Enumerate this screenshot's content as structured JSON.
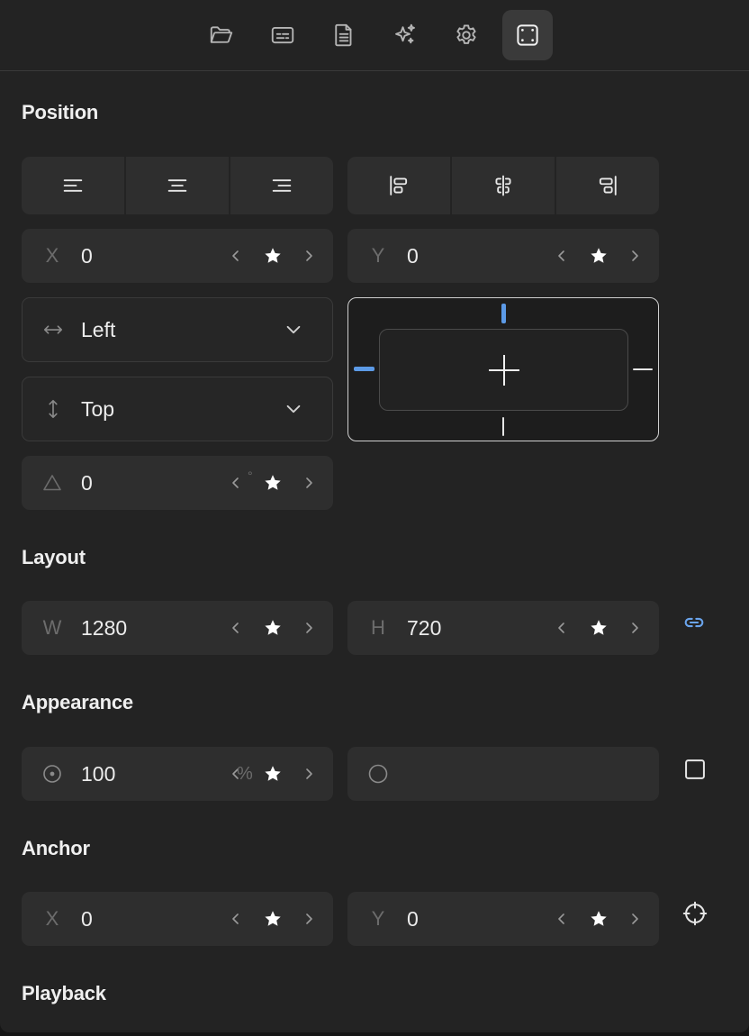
{
  "toolbar": {
    "tabs": [
      {
        "icon": "folder-open-icon"
      },
      {
        "icon": "caption-icon"
      },
      {
        "icon": "document-icon"
      },
      {
        "icon": "sparkles-icon"
      },
      {
        "icon": "gear-icon"
      },
      {
        "icon": "frame-icon",
        "active": true
      }
    ]
  },
  "position": {
    "title": "Position",
    "align_buttons": [
      "align-left-icon",
      "align-center-icon",
      "align-right-icon",
      "align-top-icon",
      "align-vertical-center-icon",
      "align-bottom-icon"
    ],
    "x": {
      "label": "X",
      "value": "0"
    },
    "y": {
      "label": "Y",
      "value": "0"
    },
    "horizontal_anchor": {
      "icon": "arrows-horizontal-icon",
      "value": "Left"
    },
    "vertical_anchor": {
      "icon": "arrows-vertical-icon",
      "value": "Top"
    },
    "rotation": {
      "icon": "triangle-icon",
      "value": "0",
      "unit": "°"
    },
    "anchor_grid": {
      "active_sides": [
        "top",
        "left"
      ]
    }
  },
  "layout": {
    "title": "Layout",
    "width": {
      "label": "W",
      "value": "1280"
    },
    "height": {
      "label": "H",
      "value": "720"
    },
    "link_icon": "link-icon"
  },
  "appearance": {
    "title": "Appearance",
    "opacity": {
      "icon": "opacity-icon",
      "value": "100",
      "unit": "%"
    },
    "blend": {
      "icon": "circle-icon",
      "value": ""
    },
    "toggle_icon": "square-icon"
  },
  "anchor": {
    "title": "Anchor",
    "x": {
      "label": "X",
      "value": "0"
    },
    "y": {
      "label": "Y",
      "value": "0"
    },
    "target_icon": "crosshair-icon"
  },
  "playback": {
    "title": "Playback"
  },
  "colors": {
    "background": "#232323",
    "field": "#2e2e2e",
    "accent": "#5c9ae6",
    "text": "#ececec"
  }
}
